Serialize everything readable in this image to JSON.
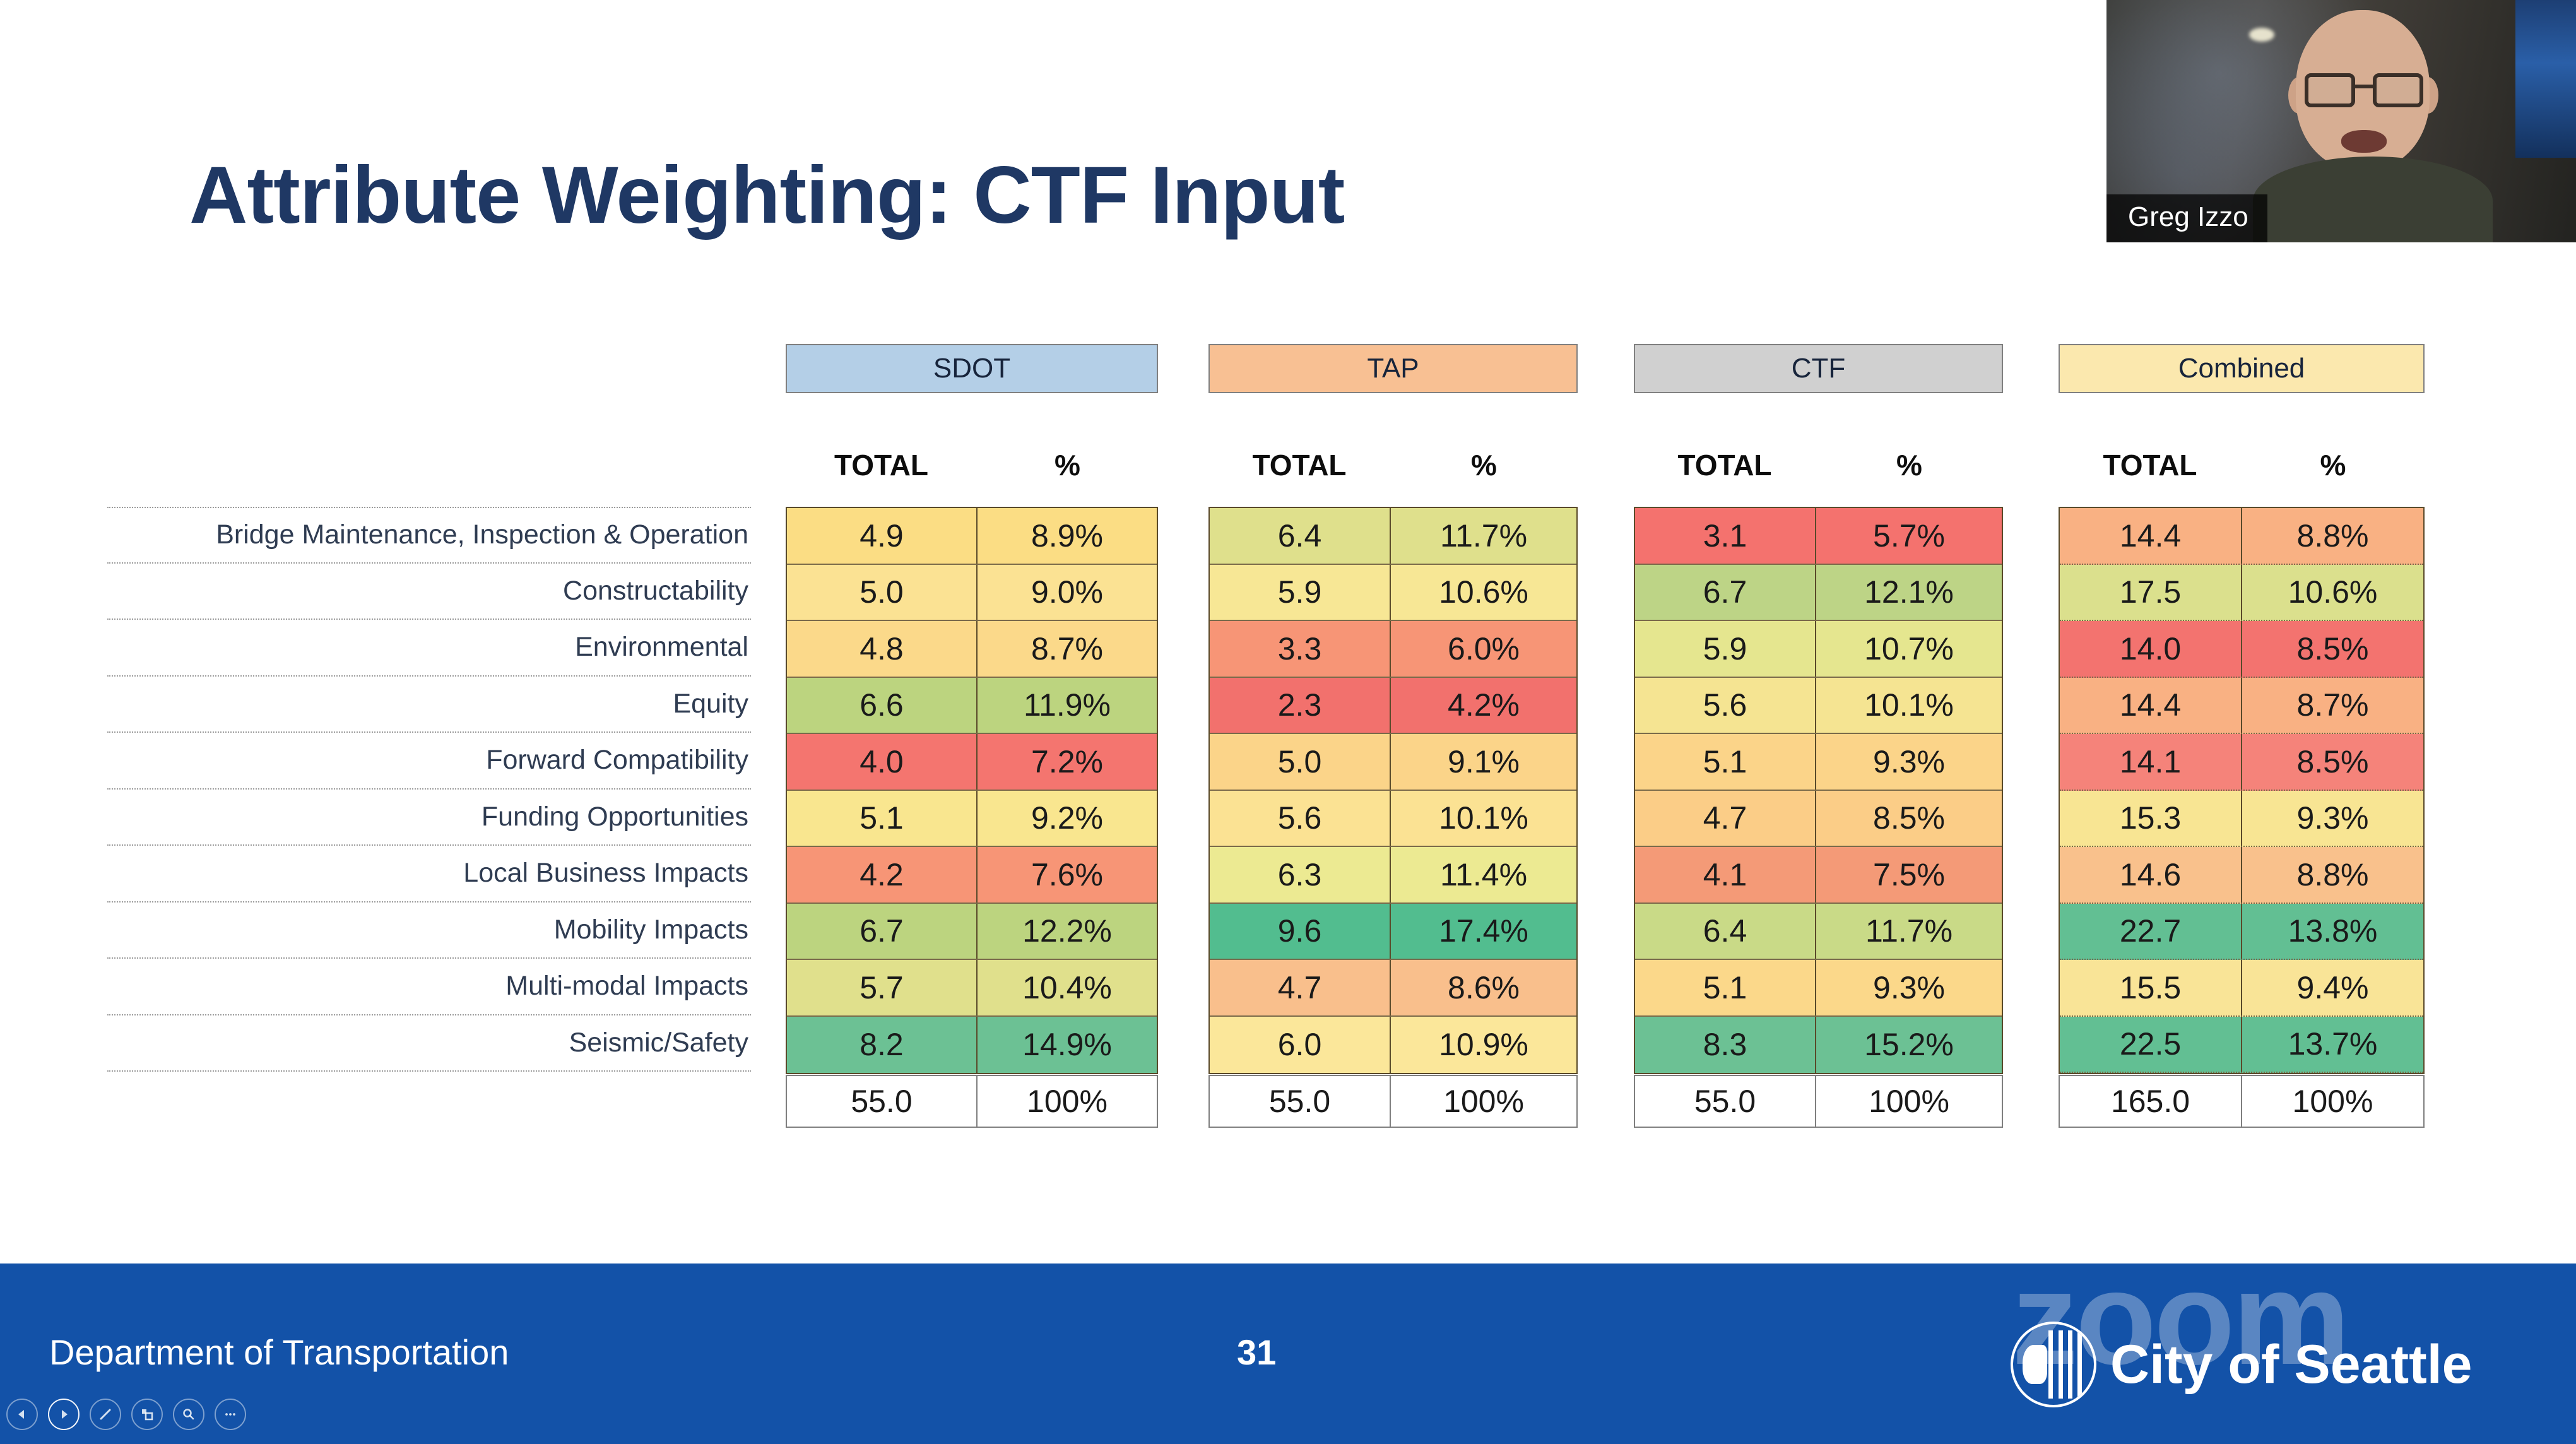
{
  "slide": {
    "title": "Attribute Weighting: CTF Input",
    "title_color": "#1f3864"
  },
  "table": {
    "groups": [
      {
        "name": "SDOT",
        "color": "#b4cfe7"
      },
      {
        "name": "TAP",
        "color": "#f8c093"
      },
      {
        "name": "CTF",
        "color": "#d0d0d0"
      },
      {
        "name": "Combined",
        "color": "#fbe8ae"
      }
    ],
    "subheaders": {
      "total": "TOTAL",
      "percent": "%"
    },
    "row_labels": [
      "Bridge Maintenance, Inspection & Operation",
      "Constructability",
      "Environmental",
      "Equity",
      "Forward Compatibility",
      "Funding Opportunities",
      "Local Business Impacts",
      "Mobility Impacts",
      "Multi-modal Impacts",
      "Seismic/Safety"
    ],
    "columns": {
      "SDOT": {
        "total": [
          "4.9",
          "5.0",
          "4.8",
          "6.6",
          "4.0",
          "5.1",
          "4.2",
          "6.7",
          "5.7",
          "8.2"
        ],
        "percent": [
          "8.9%",
          "9.0%",
          "8.7%",
          "11.9%",
          "7.2%",
          "9.2%",
          "7.6%",
          "12.2%",
          "10.4%",
          "14.9%"
        ],
        "colors": [
          "#fbdd84",
          "#fbe293",
          "#fbd98a",
          "#bcd47f",
          "#f4756f",
          "#f9e68f",
          "#f79576",
          "#bcd47f",
          "#e0e08c",
          "#6cc194"
        ],
        "footer_total": "55.0",
        "footer_percent": "100%"
      },
      "TAP": {
        "total": [
          "6.4",
          "5.9",
          "3.3",
          "2.3",
          "5.0",
          "5.6",
          "6.3",
          "9.6",
          "4.7",
          "6.0"
        ],
        "percent": [
          "11.7%",
          "10.6%",
          "6.0%",
          "4.2%",
          "9.1%",
          "10.1%",
          "11.4%",
          "17.4%",
          "8.6%",
          "10.9%"
        ],
        "colors": [
          "#dfe08c",
          "#f7e795",
          "#f79576",
          "#f2716d",
          "#fbd489",
          "#fbe293",
          "#ecea92",
          "#52bd8f",
          "#f9bf8c",
          "#fbe79a"
        ],
        "footer_total": "55.0",
        "footer_percent": "100%"
      },
      "CTF": {
        "total": [
          "3.1",
          "6.7",
          "5.9",
          "5.6",
          "5.1",
          "4.7",
          "4.1",
          "6.4",
          "5.1",
          "8.3"
        ],
        "percent": [
          "5.7%",
          "12.1%",
          "10.7%",
          "10.1%",
          "9.3%",
          "8.5%",
          "7.5%",
          "11.7%",
          "9.3%",
          "15.2%"
        ],
        "colors": [
          "#f4726e",
          "#bdd486",
          "#e5e68f",
          "#f5e492",
          "#fbd489",
          "#fbcd87",
          "#f49a77",
          "#c9da87",
          "#fbd88a",
          "#6cc194"
        ],
        "footer_total": "55.0",
        "footer_percent": "100%"
      },
      "Combined": {
        "total": [
          "14.4",
          "17.5",
          "14.0",
          "14.4",
          "14.1",
          "15.3",
          "14.6",
          "22.7",
          "15.5",
          "22.5"
        ],
        "percent": [
          "8.8%",
          "10.6%",
          "8.5%",
          "8.7%",
          "8.5%",
          "9.3%",
          "8.8%",
          "13.8%",
          "9.4%",
          "13.7%"
        ],
        "colors": [
          "#f9b183",
          "#dbe08d",
          "#f3736f",
          "#f9b183",
          "#f5837a",
          "#f8e593",
          "#f9c18c",
          "#62bf93",
          "#f9e497",
          "#62bf93"
        ],
        "footer_total": "165.0",
        "footer_percent": "100%"
      }
    }
  },
  "footer": {
    "department": "Department of Transportation",
    "page_number": "31",
    "organization": "City of Seattle",
    "watermark": "zoom",
    "bar_color": "#1352a8"
  },
  "presenter_controls": [
    {
      "name": "previous-slide",
      "glyph": "◀"
    },
    {
      "name": "next-slide",
      "glyph": "▶"
    },
    {
      "name": "pen",
      "glyph": "/"
    },
    {
      "name": "all-slides",
      "glyph": "▤"
    },
    {
      "name": "zoom-in",
      "glyph": "⌕"
    },
    {
      "name": "more-options",
      "glyph": "•••"
    }
  ],
  "video": {
    "participant_name": "Greg Izzo"
  }
}
